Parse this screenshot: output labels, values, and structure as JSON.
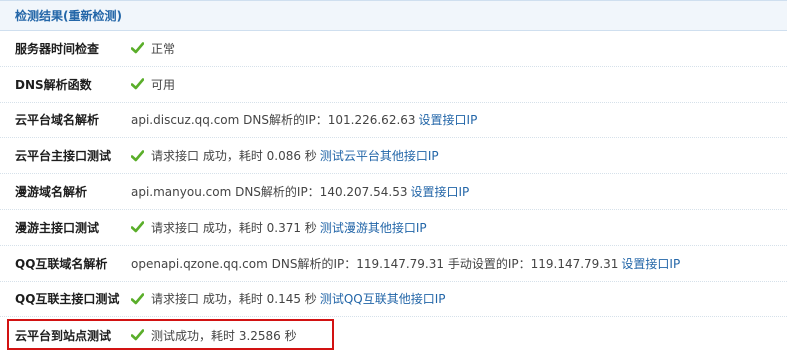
{
  "header": {
    "title": "检测结果",
    "recheck_open": "(",
    "recheck_label": "重新检测",
    "recheck_close": ")"
  },
  "rows": [
    {
      "label": "服务器时间检查",
      "check": true,
      "text": "正常"
    },
    {
      "label": "DNS解析函数",
      "check": true,
      "text": "可用"
    },
    {
      "label": "云平台域名解析",
      "check": false,
      "text": "api.discuz.qq.com DNS解析的IP：101.226.62.63",
      "link": "设置接口IP"
    },
    {
      "label": "云平台主接口测试",
      "check": true,
      "text": "请求接口 成功，耗时 0.086 秒",
      "link": "测试云平台其他接口IP"
    },
    {
      "label": "漫游域名解析",
      "check": false,
      "text": "api.manyou.com DNS解析的IP：140.207.54.53",
      "link": "设置接口IP"
    },
    {
      "label": "漫游主接口测试",
      "check": true,
      "text": "请求接口 成功，耗时 0.371 秒",
      "link": "测试漫游其他接口IP"
    },
    {
      "label": "QQ互联域名解析",
      "check": false,
      "text": "openapi.qzone.qq.com DNS解析的IP：119.147.79.31 手动设置的IP：119.147.79.31",
      "link": "设置接口IP"
    },
    {
      "label": "QQ互联主接口测试",
      "check": true,
      "text": "请求接口 成功，耗时 0.145 秒",
      "link": "测试QQ互联其他接口IP"
    },
    {
      "label": "云平台到站点测试",
      "check": true,
      "text": "测试成功，耗时 3.2586 秒"
    }
  ],
  "colors": {
    "check": "#5aae2a",
    "link": "#2366a8",
    "highlight": "#d21212"
  }
}
